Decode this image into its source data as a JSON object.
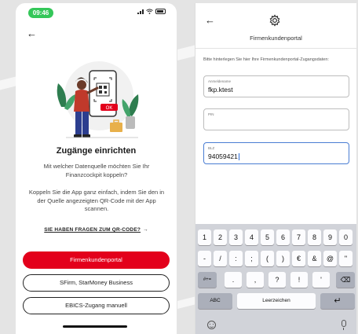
{
  "left_screen": {
    "status": {
      "time": "09:46"
    },
    "back_icon": "arrow-left",
    "heading": "Zugänge einrichten",
    "subtitle": "Mit welcher Datenquelle möchten Sie Ihr Finanzcockpit koppeln?",
    "description": "Koppeln Sie die App ganz einfach, indem Sie den in der Quelle angezeigten QR-Code mit der App scannen.",
    "qr_help_link": "SIE HABEN FRAGEN ZUM QR-CODE?",
    "qr_help_arrow": "→",
    "buttons": {
      "primary": "Firmenkundenportal",
      "sfirm": "SFirm, StarMoney Business",
      "ebics": "EBICS-Zugang manuell"
    },
    "illustration_badge": "OK"
  },
  "right_screen": {
    "back_icon": "arrow-left",
    "title": "Firmenkundenportal",
    "instruction": "Bitte hinterlegen Sie hier Ihre Firmenkundenportal-Zugangsdaten:",
    "fields": {
      "username": {
        "label": "Anmeldename",
        "value": "fkp.ktest"
      },
      "pin": {
        "label": "PIN",
        "value": ""
      },
      "blz": {
        "label": "BLZ",
        "value": "94059421"
      }
    },
    "keyboard": {
      "row1": [
        "1",
        "2",
        "3",
        "4",
        "5",
        "6",
        "7",
        "8",
        "9",
        "0"
      ],
      "row2": [
        "-",
        "/",
        ":",
        ";",
        "(",
        ")",
        "€",
        "&",
        "@",
        "\""
      ],
      "row3_left": "#+=",
      "row3": [
        ".",
        ",",
        "?",
        "!",
        "'"
      ],
      "backspace": "⌫",
      "abc": "ABC",
      "space": "Leerzeichen",
      "return": "↵"
    }
  },
  "colors": {
    "brand_red": "#e3001b",
    "status_green": "#34c759",
    "focus_blue": "#4a7dd3"
  }
}
